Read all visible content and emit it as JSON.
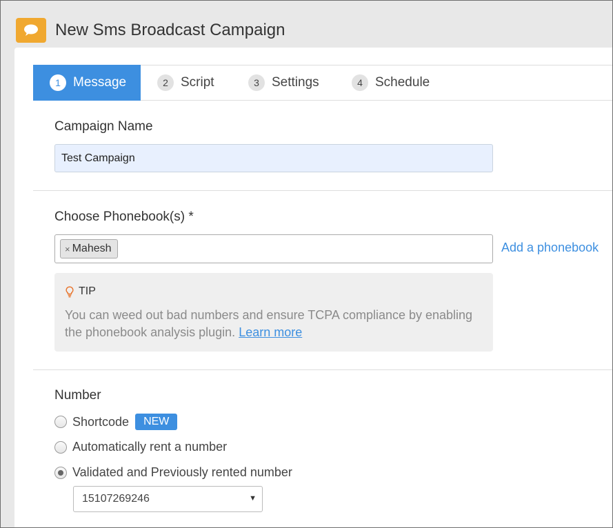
{
  "window": {
    "title": "New Sms Broadcast Campaign",
    "icon": "chat-bubble-icon",
    "accent": "#f0a830"
  },
  "tabs": [
    {
      "num": "1",
      "label": "Message",
      "active": true
    },
    {
      "num": "2",
      "label": "Script"
    },
    {
      "num": "3",
      "label": "Settings"
    },
    {
      "num": "4",
      "label": "Schedule"
    }
  ],
  "campaign": {
    "label": "Campaign Name",
    "value": "Test Campaign"
  },
  "phonebook": {
    "label": "Choose Phonebook(s) *",
    "tags": [
      {
        "remove": "×",
        "name": "Mahesh"
      }
    ],
    "add_link": "Add a phonebook"
  },
  "tip": {
    "title": "TIP",
    "icon": "lightbulb-icon",
    "text": "You can weed out bad numbers and ensure TCPA compliance by enabling the phonebook analysis plugin. ",
    "link": "Learn more"
  },
  "number": {
    "label": "Number",
    "options": [
      {
        "label": "Shortcode",
        "badge": "NEW",
        "checked": false
      },
      {
        "label": "Automatically rent a number",
        "checked": false
      },
      {
        "label": "Validated and Previously rented number",
        "checked": true
      }
    ],
    "select_value": "15107269246"
  },
  "colors": {
    "primary": "#3d8fe0",
    "tip_bg": "#efefef",
    "header_bg": "#e8e8e8"
  }
}
